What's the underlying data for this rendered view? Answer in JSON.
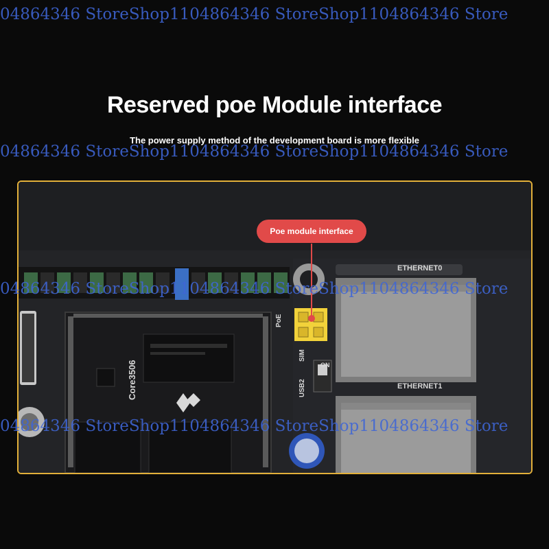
{
  "watermark": {
    "row1": "04864346 StoreShop1104864346 StoreShop1104864346 Store",
    "row2": "04864346 StoreShop1104864346 StoreShop1104864346 Store",
    "row3": "04864346 StoreShop1104864346 StoreShop1104864346 Store",
    "row4": "04864346 StoreShop1104864346 StoreShop1104864346 Store"
  },
  "heading": {
    "title": "Reserved poe Module interface",
    "subtitle": "The power supply method of the development board is more flexible"
  },
  "callout": {
    "label": "Poe module interface"
  },
  "board_labels": {
    "ethernet0": "ETHERNET0",
    "ethernet1": "ETHERNET1",
    "poe": "PoE",
    "sim": "SIM",
    "usb2": "USB2",
    "on": "ON",
    "core": "Core3506"
  },
  "colors": {
    "background": "#0a0a0a",
    "frame_border": "#e3b03a",
    "callout_bg": "#e14a49",
    "watermark": "#3f66d6",
    "poe_header": "#f2d23a"
  }
}
